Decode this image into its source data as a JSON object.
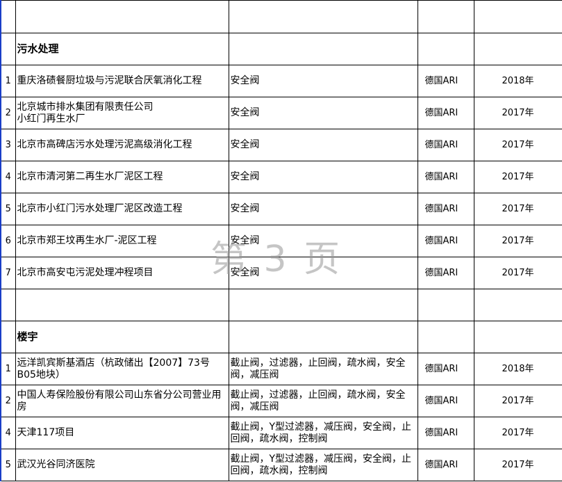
{
  "watermark": "第 3 页",
  "colors": {
    "border": "#000000",
    "accent": "#1a3ec8",
    "watermark": "#969696"
  },
  "sections": [
    {
      "title": "污水处理",
      "rows": [
        {
          "no": "1",
          "project": "重庆洛碛餐厨垃圾与污泥联合厌氧消化工程",
          "products": "安全阀",
          "brand": "德国ARI",
          "year": "2018年"
        },
        {
          "no": "2",
          "project": "北京城市排水集团有限责任公司\n小红门再生水厂",
          "products": "安全阀",
          "brand": "德国ARI",
          "year": "2017年"
        },
        {
          "no": "3",
          "project": "北京市高碑店污水处理污泥高级消化工程",
          "products": "安全阀",
          "brand": "德国ARI",
          "year": "2017年"
        },
        {
          "no": "4",
          "project": "北京市清河第二再生水厂泥区工程",
          "products": "安全阀",
          "brand": "德国ARI",
          "year": "2017年"
        },
        {
          "no": "5",
          "project": "北京市小红门污水处理厂泥区改造工程",
          "products": "安全阀",
          "brand": "德国ARI",
          "year": "2017年"
        },
        {
          "no": "6",
          "project": "北京市郑王坟再生水厂-泥区工程",
          "products": "安全阀",
          "brand": "德国ARI",
          "year": "2017年"
        },
        {
          "no": "7",
          "project": "北京市高安屯污泥处理冲程项目",
          "products": "安全阀",
          "brand": "德国ARI",
          "year": "2017年"
        }
      ]
    },
    {
      "title": "楼宇",
      "rows": [
        {
          "no": "1",
          "project": "远洋凯宾斯基酒店（杭政储出【2007】73号B05地块）",
          "products": "截止阀，过滤器，止回阀，疏水阀，安全阀，减压阀",
          "brand": "德国ARI",
          "year": "2018年"
        },
        {
          "no": "2",
          "project": "中国人寿保险股份有限公司山东省分公司营业用房",
          "products": "截止阀，过滤器，止回阀，疏水阀，安全阀，减压阀",
          "brand": "德国ARI",
          "year": "2017年"
        },
        {
          "no": "4",
          "project": "天津117项目",
          "products": "截止阀，Y型过滤器，减压阀，安全阀，止回阀，疏水阀，控制阀",
          "brand": "德国ARI",
          "year": "2017年"
        },
        {
          "no": "5",
          "project": "武汉光谷同济医院",
          "products": "截止阀，Y型过滤器，减压阀，安全阀，止回阀，疏水阀，控制阀",
          "brand": "德国ARI",
          "year": "2017年"
        }
      ]
    }
  ]
}
